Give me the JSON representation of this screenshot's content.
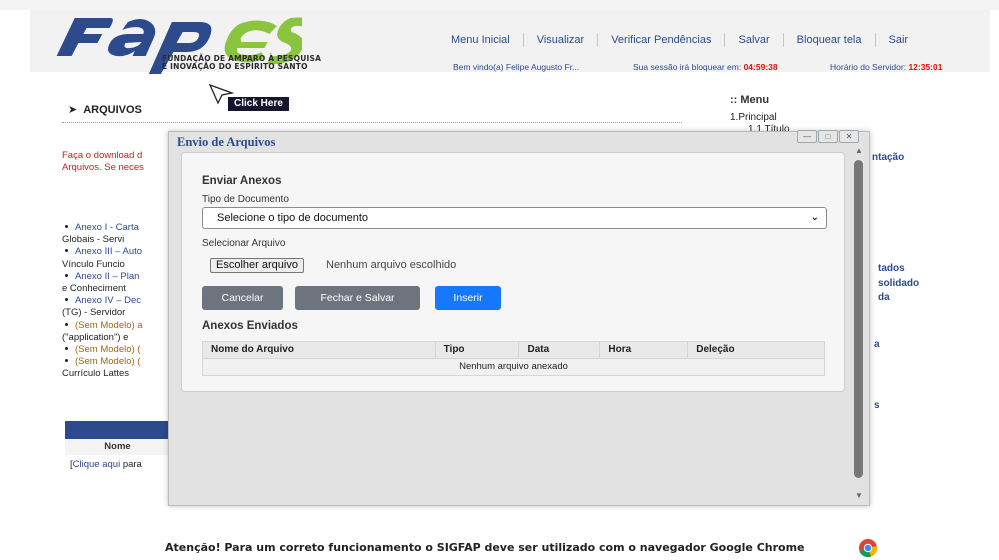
{
  "logo": {
    "word": "FAPES",
    "subtitle_line1": "FUNDAÇÃO DE AMPARO À PESQUISA",
    "subtitle_line2": "E INOVAÇÃO DO ESPÍRITO SANTO"
  },
  "topnav": [
    "Menu Inicial",
    "Visualizar",
    "Verificar Pendências",
    "Salvar",
    "Bloquear tela",
    "Sair"
  ],
  "status": {
    "welcome": "Bem vindo(a) Felipe Augusto Fr...",
    "session_label": "Sua sessão irá bloquear em:",
    "session_time": "04:59:38",
    "server_label": "Horário do Servidor:",
    "server_time": "12:35:01"
  },
  "tooltip": "Click Here",
  "section_title": "ARQUIVOS",
  "side_menu": {
    "title": ":: Menu",
    "item1": "1.Principal",
    "item2": "1.1 Título"
  },
  "right_labels": [
    "ntação",
    "tados",
    "solidado",
    "da",
    "a",
    "s"
  ],
  "download_text": [
    "Faça o download d",
    "Arquivos. Se neces"
  ],
  "annex_list": [
    {
      "bullet": true,
      "text": "Anexo I - Carta",
      "style": "blue"
    },
    {
      "bullet": false,
      "text": "Globais - Servi",
      "style": "dk"
    },
    {
      "bullet": true,
      "text": "Anexo III – Auto",
      "style": "blue"
    },
    {
      "bullet": false,
      "text": "Vínculo Funcio",
      "style": "dk"
    },
    {
      "bullet": true,
      "text": "Anexo II – Plan",
      "style": "blue"
    },
    {
      "bullet": false,
      "text": "e Conheciment",
      "style": "dk"
    },
    {
      "bullet": true,
      "text": "Anexo IV – Dec",
      "style": "blue"
    },
    {
      "bullet": false,
      "text": "(TG) - Servidor",
      "style": "dk"
    },
    {
      "bullet": true,
      "text": "(Sem Modelo) a",
      "style": "gold"
    },
    {
      "bullet": false,
      "text": "(\"application\") e",
      "style": "dk"
    },
    {
      "bullet": true,
      "text": "(Sem Modelo) (",
      "style": "gold"
    },
    {
      "bullet": true,
      "text": "(Sem Modelo) (",
      "style": "gold"
    },
    {
      "bullet": false,
      "text": "Currículo Lattes",
      "style": "dk"
    }
  ],
  "bg_table": {
    "col": "Nome",
    "link_prefix": "[",
    "link_text": "Clique aqui",
    "link_suffix": " para"
  },
  "footer": "Atenção! Para um correto funcionamento o SIGFAP deve ser utilizado com o navegador Google Chrome",
  "modal": {
    "title": "Envio de Arquivos",
    "heading": "Enviar Anexos",
    "tipo_label": "Tipo de Documento",
    "tipo_value": "Selecione o tipo de documento",
    "arquivo_label": "Selecionar Arquivo",
    "file_button": "Escolher arquivo",
    "file_status": "Nenhum arquivo escolhido",
    "buttons": {
      "cancel": "Cancelar",
      "save": "Fechar e Salvar",
      "insert": "Inserir"
    },
    "anexos_heading": "Anexos Enviados",
    "table": {
      "headers": [
        "Nome do Arquivo",
        "Tipo",
        "Data",
        "Hora",
        "Deleção"
      ],
      "empty": "Nenhum arquivo anexado"
    }
  },
  "colors": {
    "brand_blue": "#2c4a8c",
    "logo_green": "#8bc53f",
    "insert_blue": "#1677ff",
    "gray_button": "#6c757d",
    "alert_red": "#d11111"
  }
}
